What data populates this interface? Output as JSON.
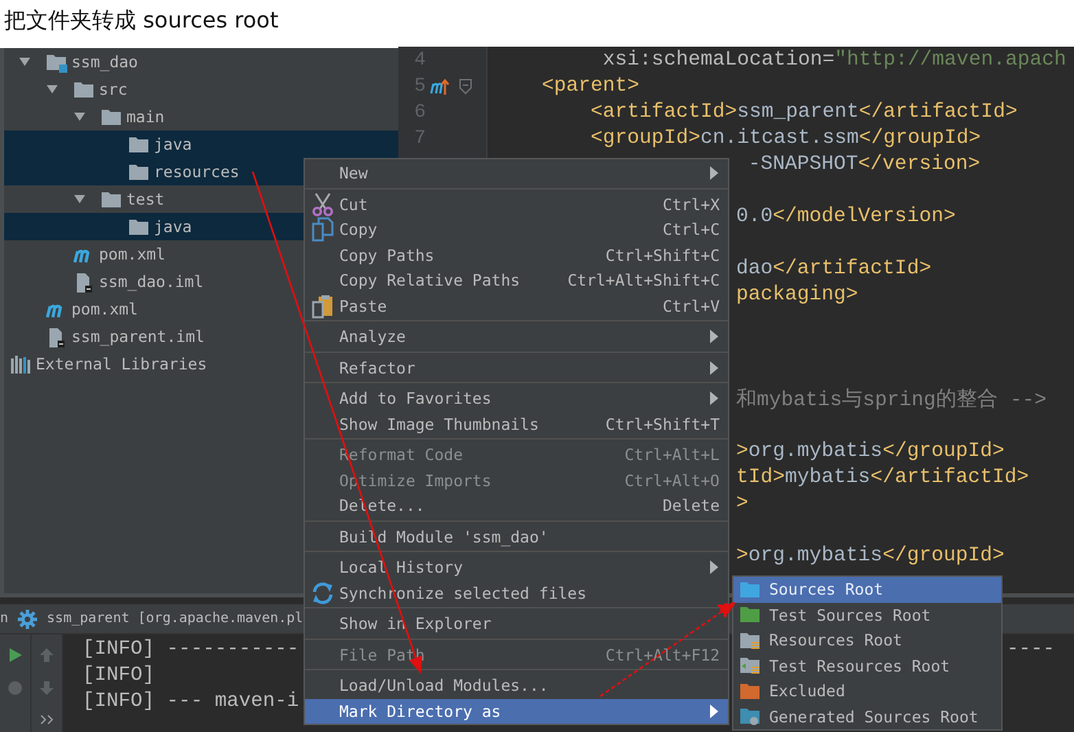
{
  "caption": "把文件夹转成 sources root",
  "project_tree": {
    "items": [
      {
        "label": "ssm_dao",
        "kind": "module",
        "expanded": true,
        "selected": false,
        "children": [
          {
            "label": "src",
            "kind": "folder",
            "expanded": true,
            "selected": false,
            "children": [
              {
                "label": "main",
                "kind": "folder",
                "expanded": true,
                "selected": false,
                "children": [
                  {
                    "label": "java",
                    "kind": "folder",
                    "selected": true
                  },
                  {
                    "label": "resources",
                    "kind": "folder",
                    "selected": true
                  }
                ]
              },
              {
                "label": "test",
                "kind": "folder",
                "expanded": true,
                "selected": false,
                "children": [
                  {
                    "label": "java",
                    "kind": "folder",
                    "selected": true
                  }
                ]
              }
            ]
          },
          {
            "label": "pom.xml",
            "kind": "maven",
            "selected": false
          },
          {
            "label": "ssm_dao.iml",
            "kind": "iml",
            "selected": false
          }
        ]
      },
      {
        "label": "pom.xml",
        "kind": "maven",
        "selected": false
      },
      {
        "label": "ssm_parent.iml",
        "kind": "iml",
        "selected": false
      }
    ],
    "external_libraries": {
      "label": "External Libraries",
      "selected": false
    }
  },
  "editor": {
    "lines": [
      {
        "kind": "full",
        "number": "4",
        "segments": [
          {
            "kind": "attr",
            "text": "         xsi:schemaLocation="
          },
          {
            "kind": "value",
            "text": "\"http://maven.apach"
          }
        ]
      },
      {
        "kind": "full",
        "number": "5",
        "maven_marker": true,
        "fold": true,
        "segments": [
          {
            "kind": "tag",
            "text": "    <parent>"
          }
        ]
      },
      {
        "kind": "full",
        "number": "6",
        "segments": [
          {
            "kind": "tag",
            "text": "        <artifactId>"
          },
          {
            "kind": "text",
            "text": "ssm_parent"
          },
          {
            "kind": "tag",
            "text": "</artifactId>"
          }
        ]
      },
      {
        "kind": "full",
        "number": "7",
        "segments": [
          {
            "kind": "tag",
            "text": "        <groupId>"
          },
          {
            "kind": "text",
            "text": "cn.itcast.ssm"
          },
          {
            "kind": "tag",
            "text": "</groupId>"
          }
        ]
      },
      {
        "kind": "clipped",
        "segments": [
          {
            "kind": "text",
            "text": " -SNAPSHOT"
          },
          {
            "kind": "tag",
            "text": "</version>"
          }
        ]
      },
      {
        "kind": "blank"
      },
      {
        "kind": "clipped",
        "segments": [
          {
            "kind": "text",
            "text": "0.0"
          },
          {
            "kind": "tag",
            "text": "</modelVersion>"
          }
        ]
      },
      {
        "kind": "blank"
      },
      {
        "kind": "clipped",
        "segments": [
          {
            "kind": "text",
            "text": "dao"
          },
          {
            "kind": "tag",
            "text": "</artifactId>"
          }
        ]
      },
      {
        "kind": "clipped",
        "segments": [
          {
            "kind": "tag",
            "text": "packaging>"
          }
        ]
      },
      {
        "kind": "blank"
      },
      {
        "kind": "blank"
      },
      {
        "kind": "blank"
      },
      {
        "kind": "clipped",
        "segments": [
          {
            "kind": "comment",
            "text": "和mybatis与spring的整合 -->"
          }
        ]
      },
      {
        "kind": "blank"
      },
      {
        "kind": "clipped",
        "segments": [
          {
            "kind": "tag",
            "text": ">"
          },
          {
            "kind": "text",
            "text": "org.mybatis"
          },
          {
            "kind": "tag",
            "text": "</groupId>"
          }
        ]
      },
      {
        "kind": "clipped",
        "segments": [
          {
            "kind": "tag",
            "text": "tId>"
          },
          {
            "kind": "text",
            "text": "mybatis"
          },
          {
            "kind": "tag",
            "text": "</artifactId>"
          }
        ]
      },
      {
        "kind": "clipped",
        "segments": [
          {
            "kind": "tag",
            "text": ">"
          }
        ]
      },
      {
        "kind": "blank"
      },
      {
        "kind": "clipped",
        "segments": [
          {
            "kind": "tag",
            "text": ">"
          },
          {
            "kind": "text",
            "text": "org.mybatis"
          },
          {
            "kind": "tag",
            "text": "</groupId>"
          }
        ]
      }
    ]
  },
  "run_panel": {
    "tab_fragment": "n",
    "title": "ssm_parent [org.apache.maven.pl",
    "console": [
      {
        "text": "[INFO] -----------",
        "tail": "----"
      },
      {
        "text": "[INFO]"
      },
      {
        "text": "[INFO] --- maven-i"
      }
    ]
  },
  "context_menu": {
    "items": [
      {
        "kind": "item",
        "label": "New",
        "submenu": true,
        "disabled": false,
        "selected": false
      },
      {
        "kind": "separator"
      },
      {
        "kind": "cut",
        "label": "Cut",
        "shortcut": "Ctrl+X",
        "disabled": false,
        "selected": false
      },
      {
        "kind": "copy",
        "label": "Copy",
        "shortcut": "Ctrl+C",
        "disabled": false,
        "selected": false
      },
      {
        "kind": "item",
        "label": "Copy Paths",
        "shortcut": "Ctrl+Shift+C",
        "disabled": false,
        "selected": false
      },
      {
        "kind": "item",
        "label": "Copy Relative Paths",
        "shortcut": "Ctrl+Alt+Shift+C",
        "disabled": false,
        "selected": false
      },
      {
        "kind": "paste",
        "label": "Paste",
        "shortcut": "Ctrl+V",
        "disabled": false,
        "selected": false
      },
      {
        "kind": "separator"
      },
      {
        "kind": "item",
        "label": "Analyze",
        "submenu": true,
        "disabled": false,
        "selected": false
      },
      {
        "kind": "separator"
      },
      {
        "kind": "item",
        "label": "Refactor",
        "submenu": true,
        "disabled": false,
        "selected": false
      },
      {
        "kind": "separator"
      },
      {
        "kind": "item",
        "label": "Add to Favorites",
        "submenu": true,
        "disabled": false,
        "selected": false
      },
      {
        "kind": "item",
        "label": "Show Image Thumbnails",
        "shortcut": "Ctrl+Shift+T",
        "disabled": false,
        "selected": false
      },
      {
        "kind": "separator"
      },
      {
        "kind": "item",
        "label": "Reformat Code",
        "shortcut": "Ctrl+Alt+L",
        "disabled": true,
        "selected": false
      },
      {
        "kind": "item",
        "label": "Optimize Imports",
        "shortcut": "Ctrl+Alt+O",
        "disabled": true,
        "selected": false
      },
      {
        "kind": "item",
        "label": "Delete...",
        "shortcut": "Delete",
        "disabled": false,
        "selected": false
      },
      {
        "kind": "separator"
      },
      {
        "kind": "item",
        "label": "Build Module 'ssm_dao'",
        "disabled": false,
        "selected": false
      },
      {
        "kind": "separator"
      },
      {
        "kind": "item",
        "label": "Local History",
        "submenu": true,
        "disabled": false,
        "selected": false
      },
      {
        "kind": "sync",
        "label": "Synchronize selected files",
        "disabled": false,
        "selected": false
      },
      {
        "kind": "separator"
      },
      {
        "kind": "item",
        "label": "Show in Explorer",
        "disabled": false,
        "selected": false
      },
      {
        "kind": "separator"
      },
      {
        "kind": "item",
        "label": "File Path",
        "shortcut": "Ctrl+Alt+F12",
        "disabled": true,
        "selected": false
      },
      {
        "kind": "separator"
      },
      {
        "kind": "item",
        "label": "Load/Unload Modules...",
        "disabled": false,
        "selected": false
      },
      {
        "kind": "item",
        "label": "Mark Directory as",
        "submenu": true,
        "disabled": false,
        "selected": true
      }
    ]
  },
  "submenu": {
    "items": [
      {
        "label": "Sources Root",
        "kind": "sources",
        "selected": true
      },
      {
        "label": "Test Sources Root",
        "kind": "test-sources",
        "selected": false
      },
      {
        "label": "Resources Root",
        "kind": "resources",
        "selected": false
      },
      {
        "label": "Test Resources Root",
        "kind": "test-resources",
        "selected": false
      },
      {
        "label": "Excluded",
        "kind": "excluded",
        "selected": false
      },
      {
        "label": "Generated Sources Root",
        "kind": "generated",
        "selected": false
      }
    ]
  }
}
